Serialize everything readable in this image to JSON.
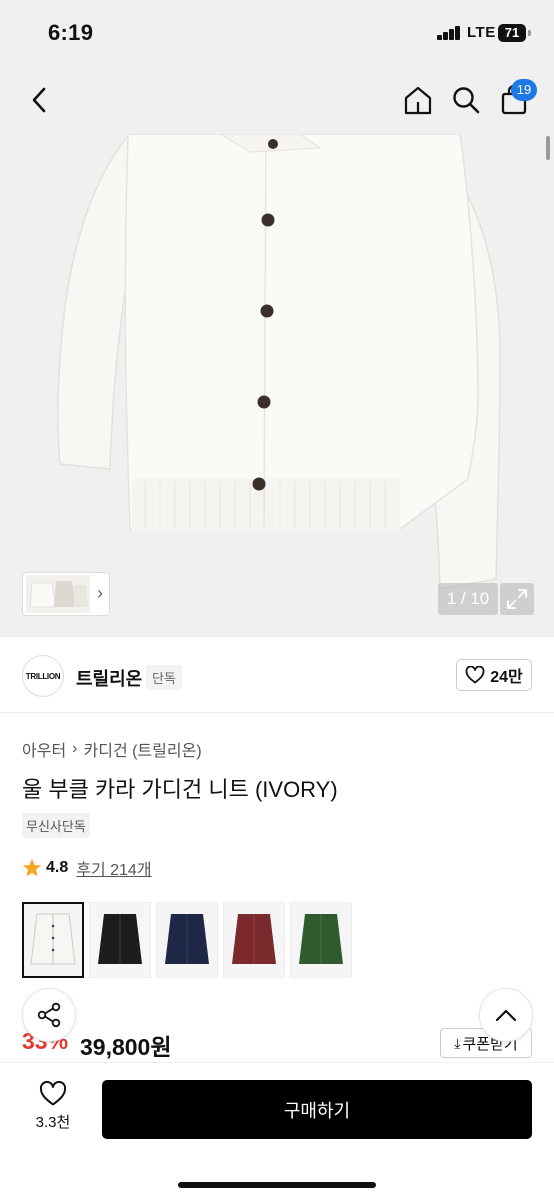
{
  "status_bar": {
    "time": "6:19",
    "network": "LTE",
    "battery": "71"
  },
  "header": {
    "cart_count": "19",
    "icons": [
      "chevron-left-icon",
      "home-icon",
      "search-icon",
      "shopping-bag-icon"
    ]
  },
  "gallery": {
    "page_counter": "1 / 10"
  },
  "brand": {
    "logo_text": "TRILLION",
    "name": "트릴리온",
    "tag": "단독",
    "like_count": "24만"
  },
  "product": {
    "breadcrumb": [
      "아우터",
      "카디건 (트릴리온)"
    ],
    "title": "울 부클 카라 가디건 니트 (IVORY)",
    "exclusive_tag": "무신사단독",
    "rating": "4.8",
    "review_label": "후기 214개",
    "colors": [
      {
        "name": "ivory",
        "hex": "#f4f3ef"
      },
      {
        "name": "black",
        "hex": "#1c1c1c"
      },
      {
        "name": "navy",
        "hex": "#1f2746"
      },
      {
        "name": "burgundy",
        "hex": "#7a2a2c"
      },
      {
        "name": "green",
        "hex": "#2f5b2e"
      }
    ]
  },
  "price": {
    "original": "원",
    "discount": "33%",
    "current": "39,800원",
    "coupon_label": "쿠폰받기"
  },
  "bottom_bar": {
    "wish_count": "3.3천",
    "buy_label": "구매하기"
  },
  "colors": {
    "accent_blue": "#1e78e6",
    "discount_red": "#e43a2f",
    "buy_button": "#000000"
  }
}
